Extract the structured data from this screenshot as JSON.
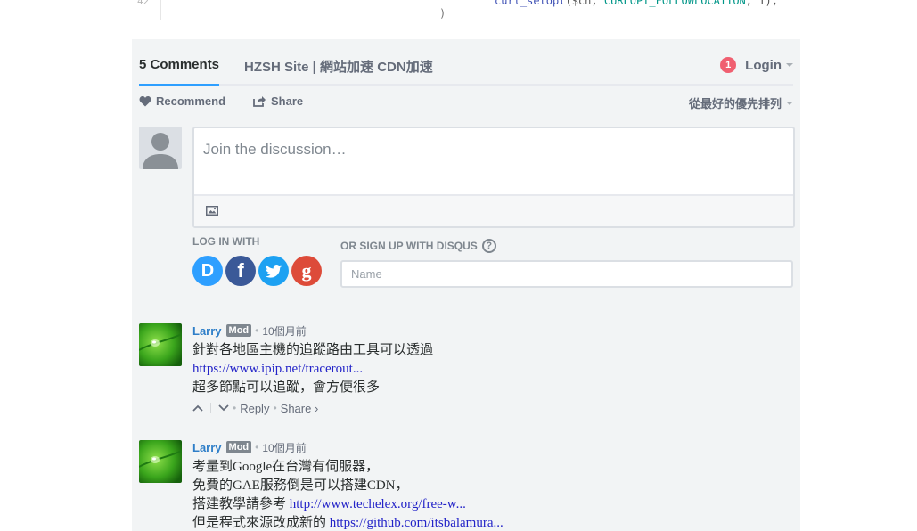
{
  "code": {
    "line_number": "42",
    "fn": "curl_setopt",
    "args_open": "($ch, ",
    "constant": "CURLOPT_FOLLOWLOCATION",
    "args_close": ", 1);",
    "brace": ")"
  },
  "nav": {
    "comments_count": "5",
    "comments_label": "Comments",
    "site_tab": "HZSH Site | 網站加速 CDN加速",
    "notification_count": "1",
    "login_label": "Login"
  },
  "actions": {
    "recommend_label": "Recommend",
    "share_label": "Share",
    "sort_label": "從最好的優先排列"
  },
  "composer": {
    "placeholder": "Join the discussion…",
    "login_with_label": "LOG IN WITH",
    "signup_label": "OR SIGN UP WITH DISQUS",
    "help_glyph": "?",
    "name_placeholder": "Name",
    "social_glyphs": {
      "disqus": "D",
      "facebook": "f",
      "google": "g"
    }
  },
  "comments": [
    {
      "author": "Larry",
      "badge": "Mod",
      "time": "10個月前",
      "lines": [
        {
          "text": "針對各地區主機的追蹤路由工具可以透過",
          "link": ""
        },
        {
          "text": "",
          "link": "https://www.ipip.net/tracerout..."
        },
        {
          "text": "超多節點可以追蹤，會方便很多",
          "link": ""
        }
      ],
      "reply_label": "Reply",
      "share_label": "Share ›"
    },
    {
      "author": "Larry",
      "badge": "Mod",
      "time": "10個月前",
      "lines": [
        {
          "text": "考量到Google在台灣有伺服器，",
          "link": ""
        },
        {
          "text": "免費的GAE服務倒是可以搭建CDN，",
          "link": ""
        },
        {
          "text": "搭建教學請參考 ",
          "link": "http://www.techelex.org/free-w..."
        },
        {
          "text": "但是程式來源改成新的 ",
          "link": "https://github.com/itsbalamura..."
        }
      ]
    }
  ],
  "colors": {
    "accent": "#2e9fff",
    "badge_red": "#f05f70",
    "link": "#2323c8",
    "author": "#2e7ec8",
    "panel_bg": "#f2f4f5"
  }
}
